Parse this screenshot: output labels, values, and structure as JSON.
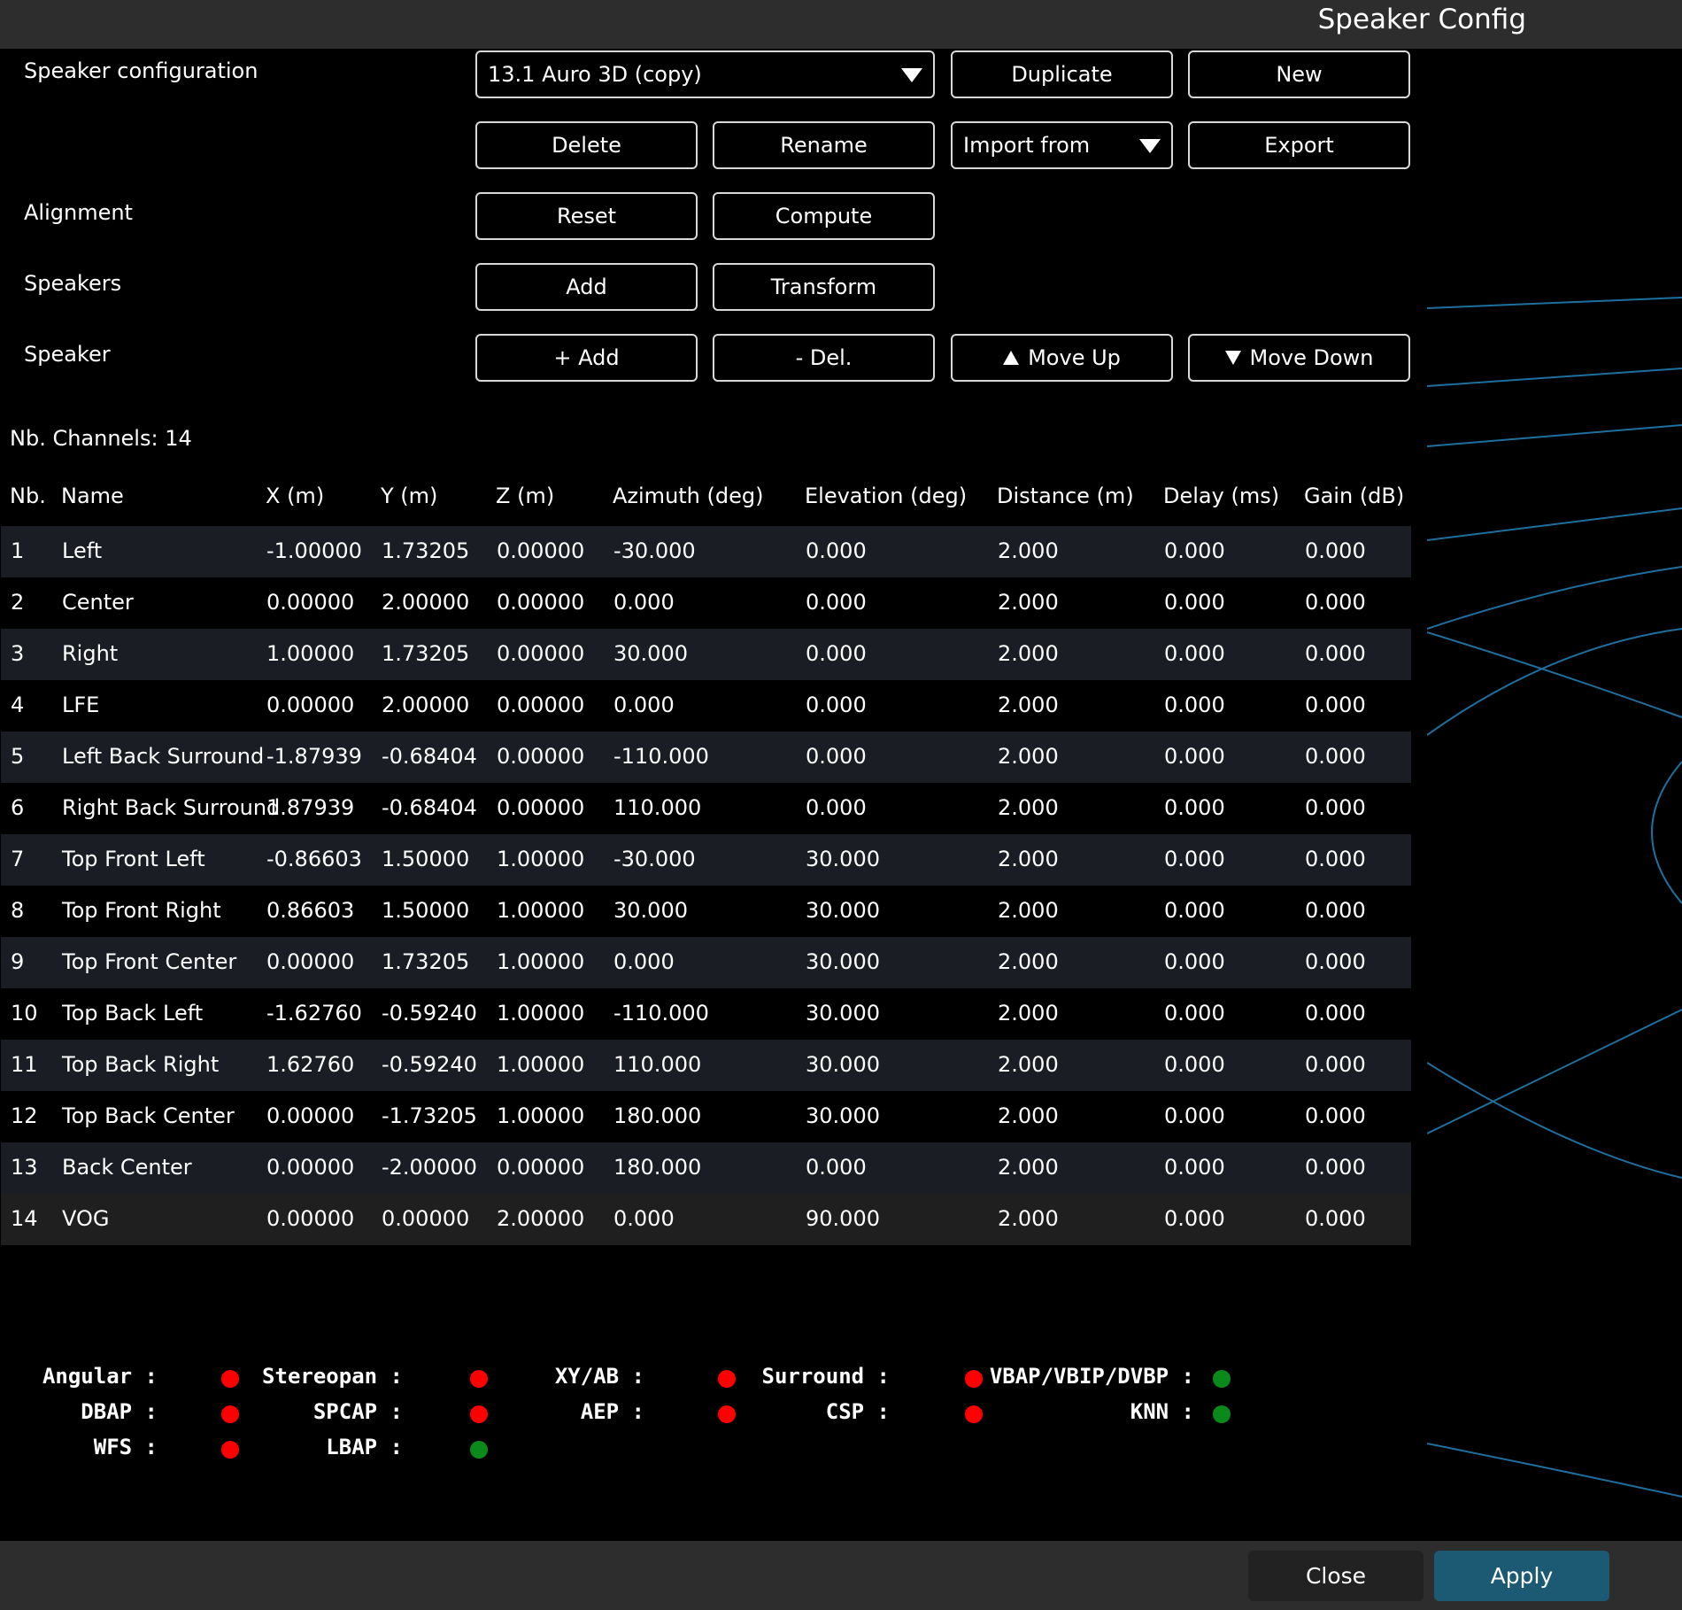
{
  "window": {
    "title": "Speaker Config"
  },
  "labels": {
    "speaker_configuration": "Speaker configuration",
    "alignment": "Alignment",
    "speakers": "Speakers",
    "speaker": "Speaker"
  },
  "config_select": {
    "value": "13.1 Auro 3D (copy)"
  },
  "buttons": {
    "duplicate": "Duplicate",
    "new": "New",
    "delete": "Delete",
    "rename": "Rename",
    "import_from": "Import from",
    "export": "Export",
    "reset": "Reset",
    "compute": "Compute",
    "speakers_add": "Add",
    "transform": "Transform",
    "speaker_add": "+ Add",
    "speaker_del": "- Del.",
    "move_up": "Move Up",
    "move_down": "Move Down"
  },
  "nb_channels": "Nb. Channels: 14",
  "table": {
    "columns": [
      "Nb.",
      "Name",
      "X (m)",
      "Y (m)",
      "Z (m)",
      "Azimuth (deg)",
      "Elevation (deg)",
      "Distance (m)",
      "Delay (ms)",
      "Gain (dB)"
    ],
    "rows": [
      [
        "1",
        "Left",
        "-1.00000",
        "1.73205",
        "0.00000",
        "-30.000",
        "0.000",
        "2.000",
        "0.000",
        "0.000"
      ],
      [
        "2",
        "Center",
        "0.00000",
        "2.00000",
        "0.00000",
        "0.000",
        "0.000",
        "2.000",
        "0.000",
        "0.000"
      ],
      [
        "3",
        "Right",
        "1.00000",
        "1.73205",
        "0.00000",
        "30.000",
        "0.000",
        "2.000",
        "0.000",
        "0.000"
      ],
      [
        "4",
        "LFE",
        "0.00000",
        "2.00000",
        "0.00000",
        "0.000",
        "0.000",
        "2.000",
        "0.000",
        "0.000"
      ],
      [
        "5",
        "Left Back Surround",
        "-1.87939",
        "-0.68404",
        "0.00000",
        "-110.000",
        "0.000",
        "2.000",
        "0.000",
        "0.000"
      ],
      [
        "6",
        "Right Back Surround",
        "1.87939",
        "-0.68404",
        "0.00000",
        "110.000",
        "0.000",
        "2.000",
        "0.000",
        "0.000"
      ],
      [
        "7",
        "Top Front Left",
        "-0.86603",
        "1.50000",
        "1.00000",
        "-30.000",
        "30.000",
        "2.000",
        "0.000",
        "0.000"
      ],
      [
        "8",
        "Top Front Right",
        "0.86603",
        "1.50000",
        "1.00000",
        "30.000",
        "30.000",
        "2.000",
        "0.000",
        "0.000"
      ],
      [
        "9",
        "Top Front Center",
        "0.00000",
        "1.73205",
        "1.00000",
        "0.000",
        "30.000",
        "2.000",
        "0.000",
        "0.000"
      ],
      [
        "10",
        "Top Back Left",
        "-1.62760",
        "-0.59240",
        "1.00000",
        "-110.000",
        "30.000",
        "2.000",
        "0.000",
        "0.000"
      ],
      [
        "11",
        "Top Back Right",
        "1.62760",
        "-0.59240",
        "1.00000",
        "110.000",
        "30.000",
        "2.000",
        "0.000",
        "0.000"
      ],
      [
        "12",
        "Top Back Center",
        "0.00000",
        "-1.73205",
        "1.00000",
        "180.000",
        "30.000",
        "2.000",
        "0.000",
        "0.000"
      ],
      [
        "13",
        "Back Center",
        "0.00000",
        "-2.00000",
        "0.00000",
        "180.000",
        "0.000",
        "2.000",
        "0.000",
        "0.000"
      ],
      [
        "14",
        "VOG",
        "0.00000",
        "0.00000",
        "2.00000",
        "0.000",
        "90.000",
        "2.000",
        "0.000",
        "0.000"
      ]
    ]
  },
  "algorithms": [
    {
      "label": "Angular :",
      "status": "red"
    },
    {
      "label": "Stereopan :",
      "status": "red"
    },
    {
      "label": "XY/AB :",
      "status": "red"
    },
    {
      "label": "Surround :",
      "status": "red"
    },
    {
      "label": "VBAP/VBIP/DVBP :",
      "status": "green"
    },
    {
      "label": "DBAP :",
      "status": "red"
    },
    {
      "label": "SPCAP :",
      "status": "red"
    },
    {
      "label": "AEP :",
      "status": "red"
    },
    {
      "label": "CSP :",
      "status": "red"
    },
    {
      "label": "KNN :",
      "status": "green"
    },
    {
      "label": "WFS :",
      "status": "red"
    },
    {
      "label": "LBAP :",
      "status": "green"
    }
  ],
  "colors": {
    "red": "#ff0000",
    "green": "#0b8a1b",
    "apply": "#1c5a73",
    "close": "#222222",
    "accent_lines": "#1f6f9e"
  },
  "footer": {
    "close": "Close",
    "apply": "Apply"
  }
}
